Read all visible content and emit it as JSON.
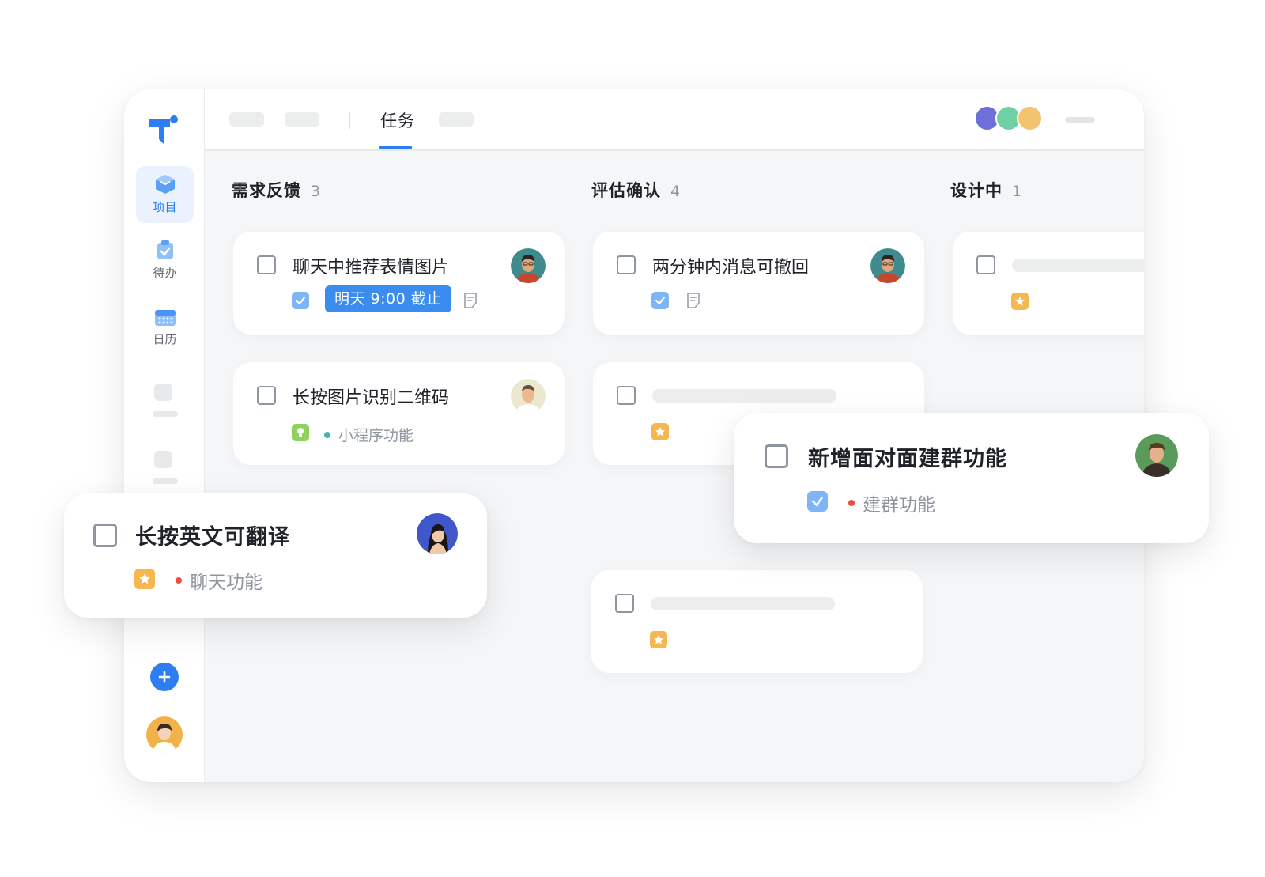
{
  "sidebar": {
    "items": [
      {
        "label": "项目",
        "icon": "project-cube-icon",
        "active": true
      },
      {
        "label": "待办",
        "icon": "clipboard-check-icon",
        "active": false
      },
      {
        "label": "日历",
        "icon": "calendar-icon",
        "active": false
      }
    ],
    "add_icon": "plus-icon"
  },
  "header": {
    "active_tab": "任务",
    "member_colors": [
      "#6e6fd8",
      "#6fd0a4",
      "#f2c46f"
    ]
  },
  "columns": [
    {
      "title": "需求反馈",
      "count": "3"
    },
    {
      "title": "评估确认",
      "count": "4"
    },
    {
      "title": "设计中",
      "count": "1"
    }
  ],
  "cards": {
    "c1": {
      "title": "聊天中推荐表情图片",
      "due": "明天 9:00 截止"
    },
    "c2": {
      "title": "长按图片识别二维码",
      "tag": "小程序功能",
      "tag_color": "#3db8a4"
    },
    "c3": {
      "title": "两分钟内消息可撤回"
    }
  },
  "floating": {
    "left": {
      "title": "长按英文可翻译",
      "tag": "聊天功能",
      "tag_color": "#f04b3e"
    },
    "right": {
      "title": "新增面对面建群功能",
      "tag": "建群功能",
      "tag_color": "#f04b3e"
    }
  },
  "colors": {
    "accent": "#2e7ef3",
    "badge": "#3b8cef",
    "star": "#f5b84f",
    "check": "#7fb5f7",
    "bulb": "#8fd15d"
  }
}
